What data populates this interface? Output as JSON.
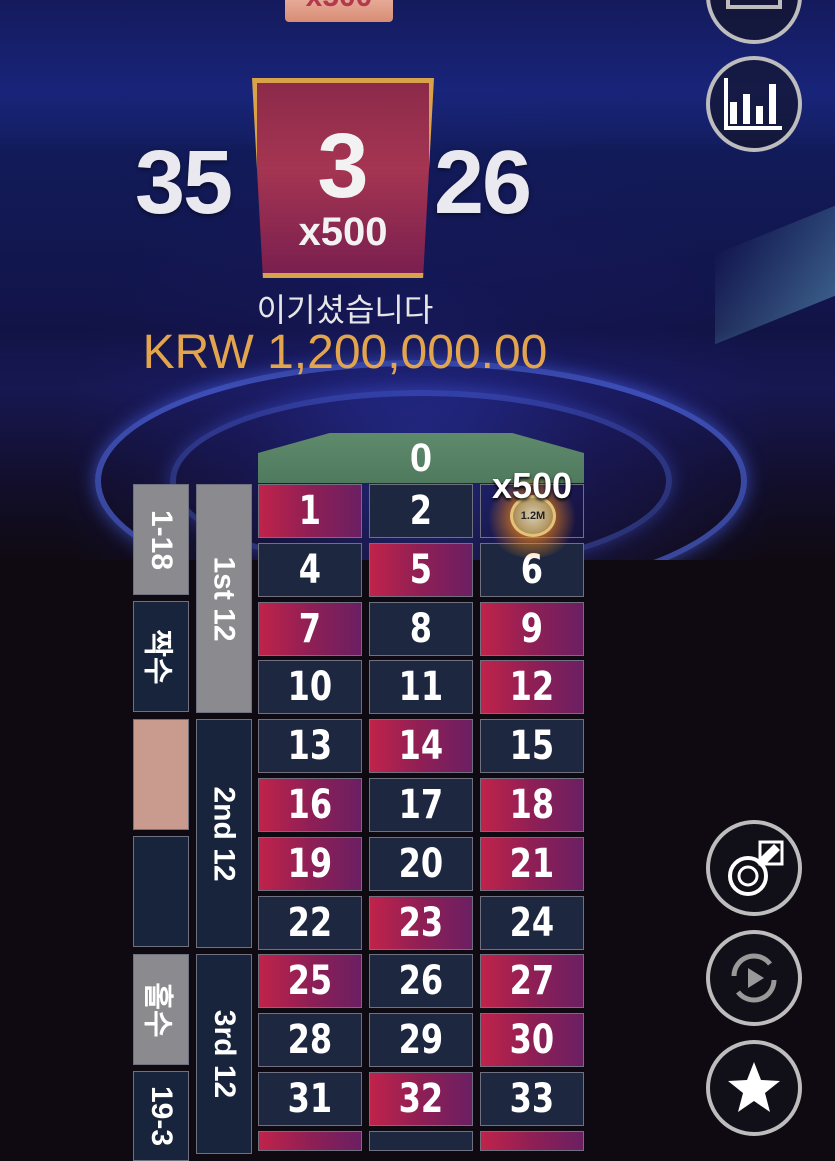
{
  "result": {
    "previous_number": "35",
    "winning_number": "3",
    "multiplier": "x500",
    "next_number": "26",
    "win_label": "이기셨습니다",
    "win_amount": "KRW 1,200,000.00",
    "top_banner_partial": "x500"
  },
  "board": {
    "zero": "0",
    "rows": [
      [
        {
          "n": "1",
          "c": "red"
        },
        {
          "n": "2",
          "c": "black"
        },
        {
          "n": "3",
          "c": "lightning"
        }
      ],
      [
        {
          "n": "4",
          "c": "black"
        },
        {
          "n": "5",
          "c": "red"
        },
        {
          "n": "6",
          "c": "black"
        }
      ],
      [
        {
          "n": "7",
          "c": "red"
        },
        {
          "n": "8",
          "c": "black"
        },
        {
          "n": "9",
          "c": "red"
        }
      ],
      [
        {
          "n": "10",
          "c": "black"
        },
        {
          "n": "11",
          "c": "black"
        },
        {
          "n": "12",
          "c": "red"
        }
      ],
      [
        {
          "n": "13",
          "c": "black"
        },
        {
          "n": "14",
          "c": "red"
        },
        {
          "n": "15",
          "c": "black"
        }
      ],
      [
        {
          "n": "16",
          "c": "red"
        },
        {
          "n": "17",
          "c": "black"
        },
        {
          "n": "18",
          "c": "red"
        }
      ],
      [
        {
          "n": "19",
          "c": "red"
        },
        {
          "n": "20",
          "c": "black"
        },
        {
          "n": "21",
          "c": "red"
        }
      ],
      [
        {
          "n": "22",
          "c": "black"
        },
        {
          "n": "23",
          "c": "red"
        },
        {
          "n": "24",
          "c": "black"
        }
      ],
      [
        {
          "n": "25",
          "c": "red"
        },
        {
          "n": "26",
          "c": "black"
        },
        {
          "n": "27",
          "c": "red"
        }
      ],
      [
        {
          "n": "28",
          "c": "black"
        },
        {
          "n": "29",
          "c": "black"
        },
        {
          "n": "30",
          "c": "red"
        }
      ],
      [
        {
          "n": "31",
          "c": "black"
        },
        {
          "n": "32",
          "c": "red"
        },
        {
          "n": "33",
          "c": "black"
        }
      ]
    ],
    "dozens": [
      "1st 12",
      "2nd 12",
      "3rd 12"
    ],
    "outside": [
      "1-18",
      "짝수",
      "",
      "",
      "홀수",
      "19-3"
    ],
    "lightning_multiplier": "x500",
    "chip_value": "1.2M"
  },
  "controls": {
    "stats_icon": "bar-chart-icon",
    "chip_edit_icon": "chip-edit-icon",
    "repeat_icon": "repeat-play-icon",
    "favorite_icon": "star-icon"
  },
  "colors": {
    "red": "#b0234e",
    "black": "#1d2740",
    "zero": "#5f8a6c",
    "gold": "#e2a54d"
  }
}
